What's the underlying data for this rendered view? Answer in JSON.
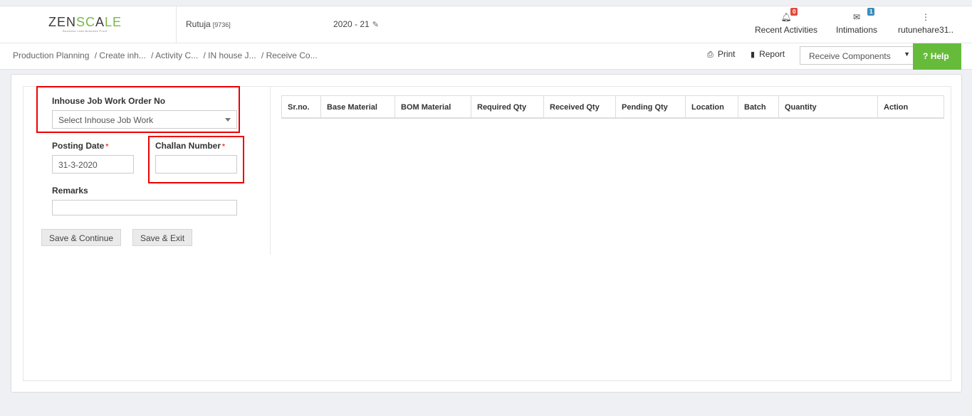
{
  "header": {
    "logo": {
      "left": "ZEN",
      "mid": "SC",
      "accent": "A",
      "right": "LE",
      "tagline": "Business Leak Business Proof"
    },
    "user_name": "Rutuja",
    "user_id": "[9736]",
    "fiscal_year": "2020 - 21",
    "recent_activities": {
      "label": "Recent Activities",
      "badge": "0"
    },
    "intimations": {
      "label": "Intimations",
      "badge": "1"
    },
    "account": {
      "label": "rutunehare31.."
    }
  },
  "breadcrumb": [
    "Production Planning",
    "/ Create inh...",
    "/ Activity C...",
    "/ IN house J...",
    "/ Receive Co..."
  ],
  "toolbar": {
    "print": "Print",
    "report": "Report",
    "selected_view": "Receive Components",
    "help": "Help"
  },
  "form": {
    "job_order_label": "Inhouse Job Work Order No",
    "job_order_placeholder": "Select Inhouse Job Work",
    "posting_date_label": "Posting Date",
    "posting_date_value": "31-3-2020",
    "challan_label": "Challan Number",
    "challan_value": "",
    "remarks_label": "Remarks",
    "remarks_value": "",
    "required_marker": "*",
    "save_continue": "Save & Continue",
    "save_exit": "Save & Exit"
  },
  "table": {
    "columns": [
      "Sr.no.",
      "Base Material",
      "BOM Material",
      "Required Qty",
      "Received Qty",
      "Pending Qty",
      "Location",
      "Batch",
      "Quantity",
      "Action"
    ]
  },
  "colors": {
    "accent_green": "#66bb3b",
    "highlight_red": "#e00000",
    "badge_red": "#e04b3b",
    "badge_blue": "#3c8dbc"
  }
}
